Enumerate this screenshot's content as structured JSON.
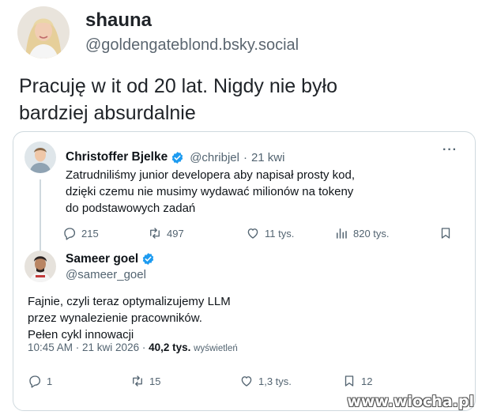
{
  "post": {
    "display_name": "shauna",
    "handle": "@goldengateblond.bsky.social",
    "text_line1": "Pracuję w it od 20 lat. Nigdy nie było",
    "text_line2": "bardziej absurdalnie"
  },
  "quoted_tweet": {
    "display_name": "Christoffer Bjelke",
    "handle": "@chribjel",
    "dot": "·",
    "time": "21 kwi",
    "more": "···",
    "text_line1": "Zatrudniliśmy junior developera aby napisał prosty kod,",
    "text_line2": "dzięki czemu nie musimy wydawać milionów na tokeny",
    "text_line3": "do podstawowych zadań",
    "actions": {
      "replies": "215",
      "retweets": "497",
      "likes": "11 tys.",
      "views": "820 tys."
    }
  },
  "reply_tweet": {
    "display_name": "Sameer goel",
    "handle": "@sameer_goel",
    "text_line1": "Fajnie, czyli teraz optymalizujemy LLM",
    "text_line2": "przez wynalezienie pracowników.",
    "text_line3": "Pełen cykl innowacji",
    "timestamp": "10:45 AM · 21 kwi 2026 ·",
    "views_count": "40,2 tys.",
    "views_label": "wyświetleń",
    "actions": {
      "replies": "1",
      "retweets": "15",
      "likes": "1,3 tys.",
      "bookmarks": "12"
    }
  },
  "watermark": "www.wiocha.pl",
  "colors": {
    "verified": "#1d9bf0",
    "muted": "#536471",
    "border": "#cfd9de"
  }
}
